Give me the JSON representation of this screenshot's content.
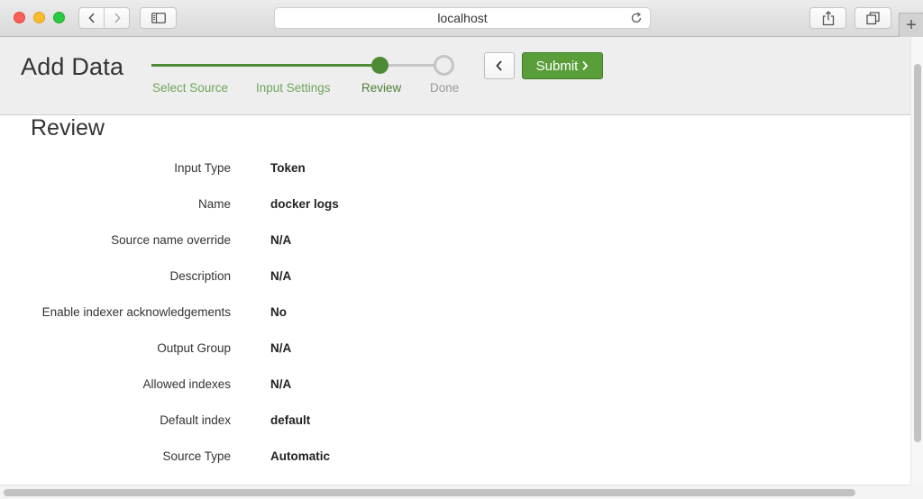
{
  "browser": {
    "url": "localhost",
    "icons": {
      "back": "chevron-left-icon",
      "forward": "chevron-right-icon",
      "sidebar": "sidebar-icon",
      "reload": "reload-icon",
      "share": "share-icon",
      "tabs": "tabs-icon",
      "new_tab": "plus-icon"
    },
    "new_tab_label": "+"
  },
  "header": {
    "title": "Add Data",
    "steps": [
      {
        "label": "Select Source",
        "state": "complete"
      },
      {
        "label": "Input Settings",
        "state": "complete"
      },
      {
        "label": "Review",
        "state": "current"
      },
      {
        "label": "Done",
        "state": "pending"
      }
    ],
    "submit_label": "Submit",
    "accent_color": "#5a9e3a"
  },
  "review": {
    "title": "Review",
    "rows": [
      {
        "label": "Input Type",
        "value": "Token"
      },
      {
        "label": "Name",
        "value": "docker logs"
      },
      {
        "label": "Source name override",
        "value": "N/A"
      },
      {
        "label": "Description",
        "value": "N/A"
      },
      {
        "label": "Enable indexer acknowledgements",
        "value": "No"
      },
      {
        "label": "Output Group",
        "value": "N/A"
      },
      {
        "label": "Allowed indexes",
        "value": "N/A"
      },
      {
        "label": "Default index",
        "value": "default"
      },
      {
        "label": "Source Type",
        "value": "Automatic"
      }
    ]
  }
}
